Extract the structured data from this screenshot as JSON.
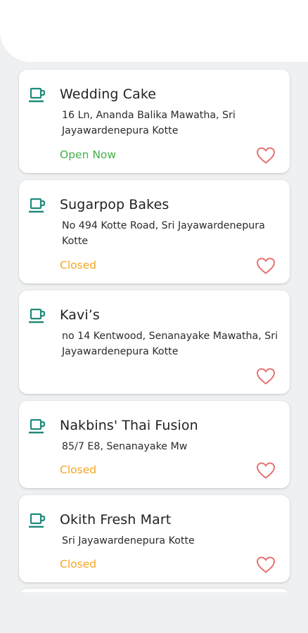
{
  "colors": {
    "accent_teal": "#1f8a7a",
    "open_green": "#43b047",
    "closed_orange": "#f5a623",
    "heart_red": "#e57373"
  },
  "places": [
    {
      "name": "Wedding Cake",
      "address": "16 Ln, Ananda Balika Mawatha, Sri Jayawardenepura Kotte",
      "status": "Open Now",
      "status_type": "open",
      "icon": "cup-icon",
      "favorite_icon": "heart-outline-icon"
    },
    {
      "name": "Sugarpop Bakes",
      "address": "No 494 Kotte Road, Sri Jayawardenepura Kotte",
      "status": "Closed",
      "status_type": "closed",
      "icon": "cup-icon",
      "favorite_icon": "heart-outline-icon"
    },
    {
      "name": "Kavi’s",
      "address": "no 14 Kentwood, Senanayake Mawatha, Sri Jayawardenepura Kotte",
      "status": "",
      "status_type": "none",
      "icon": "cup-icon",
      "favorite_icon": "heart-outline-icon"
    },
    {
      "name": "Nakbins' Thai Fusion",
      "address": "85/7 E8, Senanayake Mw",
      "status": "Closed",
      "status_type": "closed",
      "icon": "cup-icon",
      "favorite_icon": "heart-outline-icon"
    },
    {
      "name": "Okith Fresh Mart",
      "address": "Sri Jayawardenepura Kotte",
      "status": "Closed",
      "status_type": "closed",
      "icon": "cup-icon",
      "favorite_icon": "heart-outline-icon"
    }
  ]
}
